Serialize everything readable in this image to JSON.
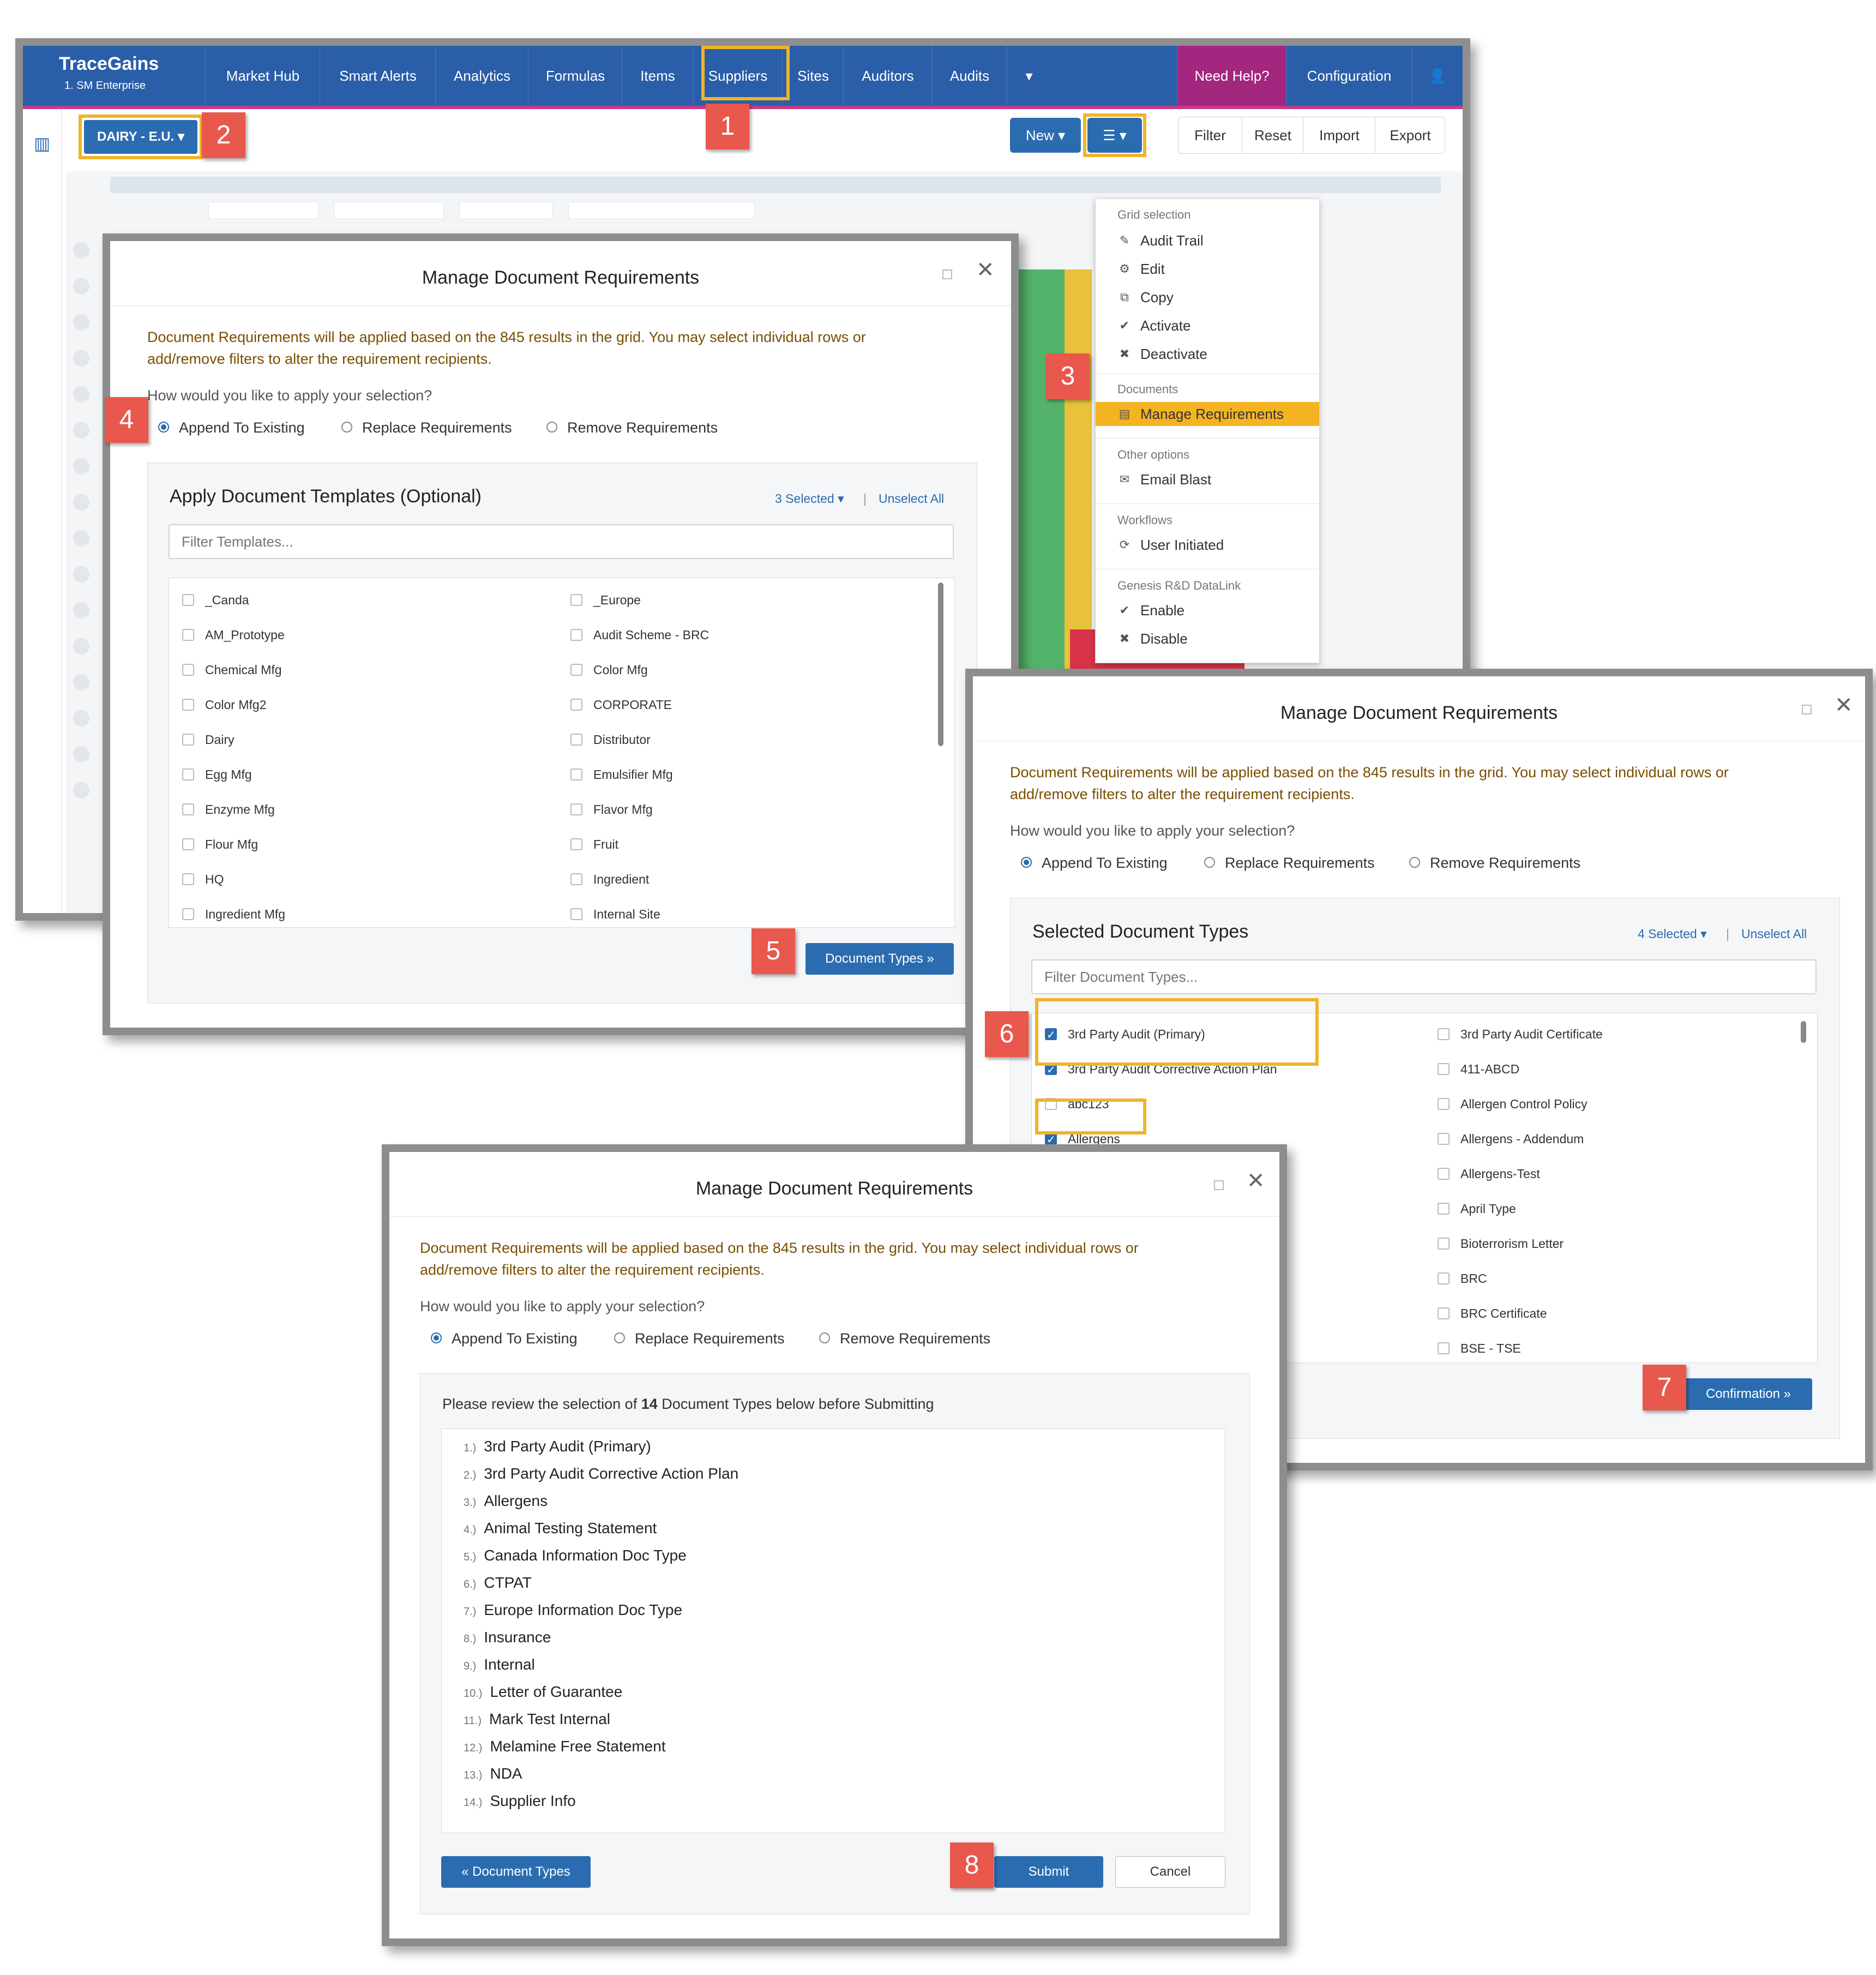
{
  "app": {
    "brand": "TraceGains",
    "enterprise": "1. SM Enterprise",
    "nav": [
      "Market Hub",
      "Smart Alerts",
      "Analytics",
      "Formulas",
      "Items",
      "Suppliers",
      "Sites",
      "Auditors",
      "Audits"
    ],
    "nav_more": "▾",
    "help": "Need Help?",
    "config": "Configuration",
    "user_icon": "user-icon",
    "filter_badge": "DAIRY - E.U. ▾",
    "new_btn": "New ▾",
    "menu_btn": "☰ ▾",
    "toolbar": [
      "Filter",
      "Reset",
      "Import",
      "Export"
    ],
    "colors": {
      "nav": "#2b5ea8",
      "help": "#a3267f",
      "highlight": "#f0b429",
      "badge": "#e8584c",
      "accent": "#2b6cb0"
    }
  },
  "menu": {
    "sections": [
      {
        "header": "Grid selection",
        "items": [
          {
            "icon": "pencil-icon",
            "glyph": "✎",
            "label": "Audit Trail"
          },
          {
            "icon": "gear-icon",
            "glyph": "⚙",
            "label": "Edit"
          },
          {
            "icon": "copy-icon",
            "glyph": "⧉",
            "label": "Copy"
          },
          {
            "icon": "check-icon",
            "glyph": "✔",
            "label": "Activate"
          },
          {
            "icon": "x-icon",
            "glyph": "✖",
            "label": "Deactivate"
          }
        ]
      },
      {
        "header": "Documents",
        "items": [
          {
            "icon": "document-icon",
            "glyph": "▤",
            "label": "Manage Requirements"
          }
        ]
      },
      {
        "header": "Other options",
        "items": [
          {
            "icon": "envelope-icon",
            "glyph": "✉",
            "label": "Email Blast"
          }
        ]
      },
      {
        "header": "Workflows",
        "items": [
          {
            "icon": "refresh-icon",
            "glyph": "⟳",
            "label": "User Initiated"
          }
        ]
      },
      {
        "header": "Genesis R&D DataLink",
        "items": [
          {
            "icon": "check-icon",
            "glyph": "✔",
            "label": "Enable"
          },
          {
            "icon": "x-icon",
            "glyph": "✖",
            "label": "Disable"
          }
        ]
      }
    ]
  },
  "dialog": {
    "title": "Manage Document Requirements",
    "notice_line1": "Document Requirements will be applied based on the 845 results in the grid. You may select individual rows or",
    "notice_line2": "add/remove filters to alter the requirement recipients.",
    "question": "How would you like to apply your selection?",
    "options": [
      "Append To Existing",
      "Replace Requirements",
      "Remove Requirements"
    ]
  },
  "templates": {
    "title": "Apply Document Templates (Optional)",
    "selected": "3 Selected ▾",
    "sep": "|",
    "unselect": "Unselect All",
    "placeholder": "Filter Templates...",
    "items": [
      "_Canda",
      "_Europe",
      "AM_Prototype",
      "Audit Scheme - BRC",
      "Chemical Mfg",
      "Color Mfg",
      "Color Mfg2",
      "CORPORATE",
      "Dairy",
      "Distributor",
      "Egg Mfg",
      "Emulsifier Mfg",
      "Enzyme Mfg",
      "Flavor Mfg",
      "Flour Mfg",
      "Fruit",
      "HQ",
      "Ingredient",
      "Ingredient Mfg",
      "Internal Site"
    ],
    "next_btn": "Document Types »"
  },
  "doctypes": {
    "title": "Selected Document Types",
    "selected": "4 Selected ▾",
    "sep": "|",
    "unselect": "Unselect All",
    "placeholder": "Filter Document Types...",
    "left": [
      {
        "label": "3rd Party Audit (Primary)",
        "checked": true
      },
      {
        "label": "3rd Party Audit Corrective Action Plan",
        "checked": true
      },
      {
        "label": "abc123",
        "checked": false
      },
      {
        "label": "Allergens",
        "checked": true
      }
    ],
    "right": [
      "3rd Party Audit Certificate",
      "411-ABCD",
      "Allergen Control Policy",
      "Allergens - Addendum",
      "Allergens-Test",
      "April Type",
      "Bioterrorism Letter",
      "BRC",
      "BRC Certificate",
      "BSE - TSE"
    ],
    "next_btn": "Confirmation »"
  },
  "review": {
    "prefix": "Please review the selection of ",
    "count": "14",
    "suffix": " Document Types below before Submitting",
    "items": [
      "3rd Party Audit (Primary)",
      "3rd Party Audit Corrective Action Plan",
      "Allergens",
      "Animal Testing Statement",
      "Canada Information Doc Type",
      "CTPAT",
      "Europe Information Doc Type",
      "Insurance",
      "Internal",
      "Letter of Guarantee",
      "Mark Test Internal",
      "Melamine Free Statement",
      "NDA",
      "Supplier Info"
    ],
    "back_btn": "« Document Types",
    "submit_btn": "Submit",
    "cancel_btn": "Cancel"
  },
  "badges": [
    "1",
    "2",
    "3",
    "4",
    "5",
    "6",
    "7",
    "8"
  ]
}
